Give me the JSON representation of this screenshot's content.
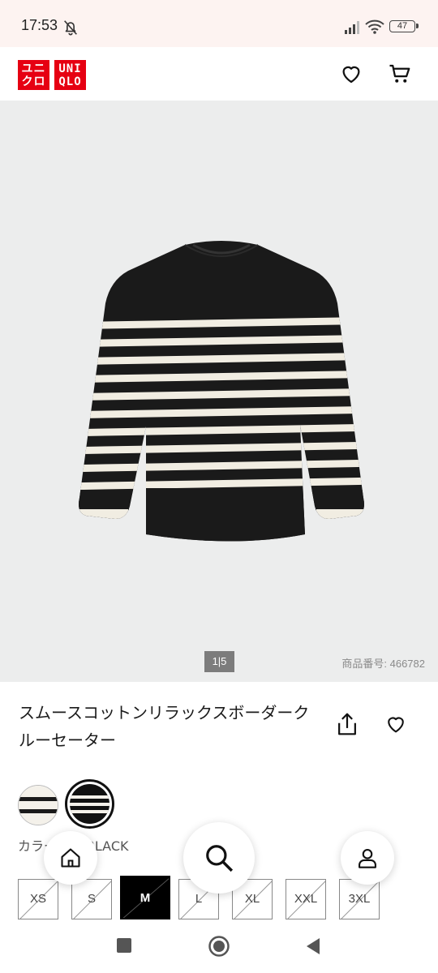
{
  "status": {
    "time": "17:53",
    "battery": "47"
  },
  "brand": {
    "logo_line1": "ユニ",
    "logo_line2": "クロ",
    "logo_en1": "UNI",
    "logo_en2": "QLO"
  },
  "gallery": {
    "counter": "1|5",
    "product_number": "商品番号: 466782"
  },
  "product": {
    "title": "スムースコットンリラックスボーダークルーセーター"
  },
  "color": {
    "label": "カラー: 09 BLACK"
  },
  "sizes": [
    {
      "label": "XS",
      "available": false,
      "selected": false
    },
    {
      "label": "S",
      "available": false,
      "selected": false
    },
    {
      "label": "M",
      "available": false,
      "selected": true
    },
    {
      "label": "L",
      "available": false,
      "selected": false
    },
    {
      "label": "XL",
      "available": false,
      "selected": false
    },
    {
      "label": "XXL",
      "available": false,
      "selected": false
    },
    {
      "label": "3XL",
      "available": false,
      "selected": false
    }
  ],
  "icons": {
    "bell": "bell-off-icon",
    "signal": "signal-icon",
    "wifi": "wifi-icon",
    "favorite": "heart-icon",
    "cart": "cart-icon",
    "share": "share-icon",
    "home": "home-icon",
    "search": "search-icon",
    "account": "user-icon"
  },
  "colors": {
    "brand_red": "#e60012",
    "gallery_bg": "#eceded",
    "counter_bg": "#7c7c7c"
  }
}
